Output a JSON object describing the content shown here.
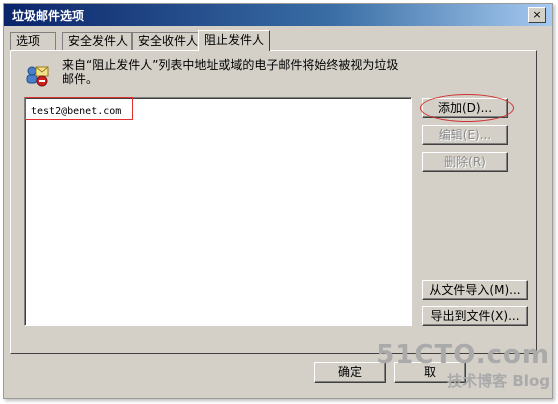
{
  "window": {
    "title": "垃圾邮件选项",
    "close_symbol": "×"
  },
  "tabs": [
    {
      "label": "选项",
      "active": false
    },
    {
      "label": "安全发件人",
      "active": false
    },
    {
      "label": "安全收件人",
      "active": false
    },
    {
      "label": "阻止发件人",
      "active": true
    }
  ],
  "info": {
    "icon": "junk-mail-blocked-icon",
    "text": "来自“阻止发件人”列表中地址或域的电子邮件将始终被视为垃圾邮件。"
  },
  "blocked_list": {
    "items": [
      "test2@benet.com"
    ]
  },
  "side_buttons": {
    "add": "添加(D)...",
    "edit": "编辑(E)...",
    "remove": "删除(R)",
    "import": "从文件导入(M)...",
    "export": "导出到文件(X)..."
  },
  "footer": {
    "ok": "确定",
    "cancel": "取"
  },
  "watermark": {
    "line1": "51CTO.com",
    "line2": "技术博客 Blog"
  },
  "annotation_color": "#e03030"
}
